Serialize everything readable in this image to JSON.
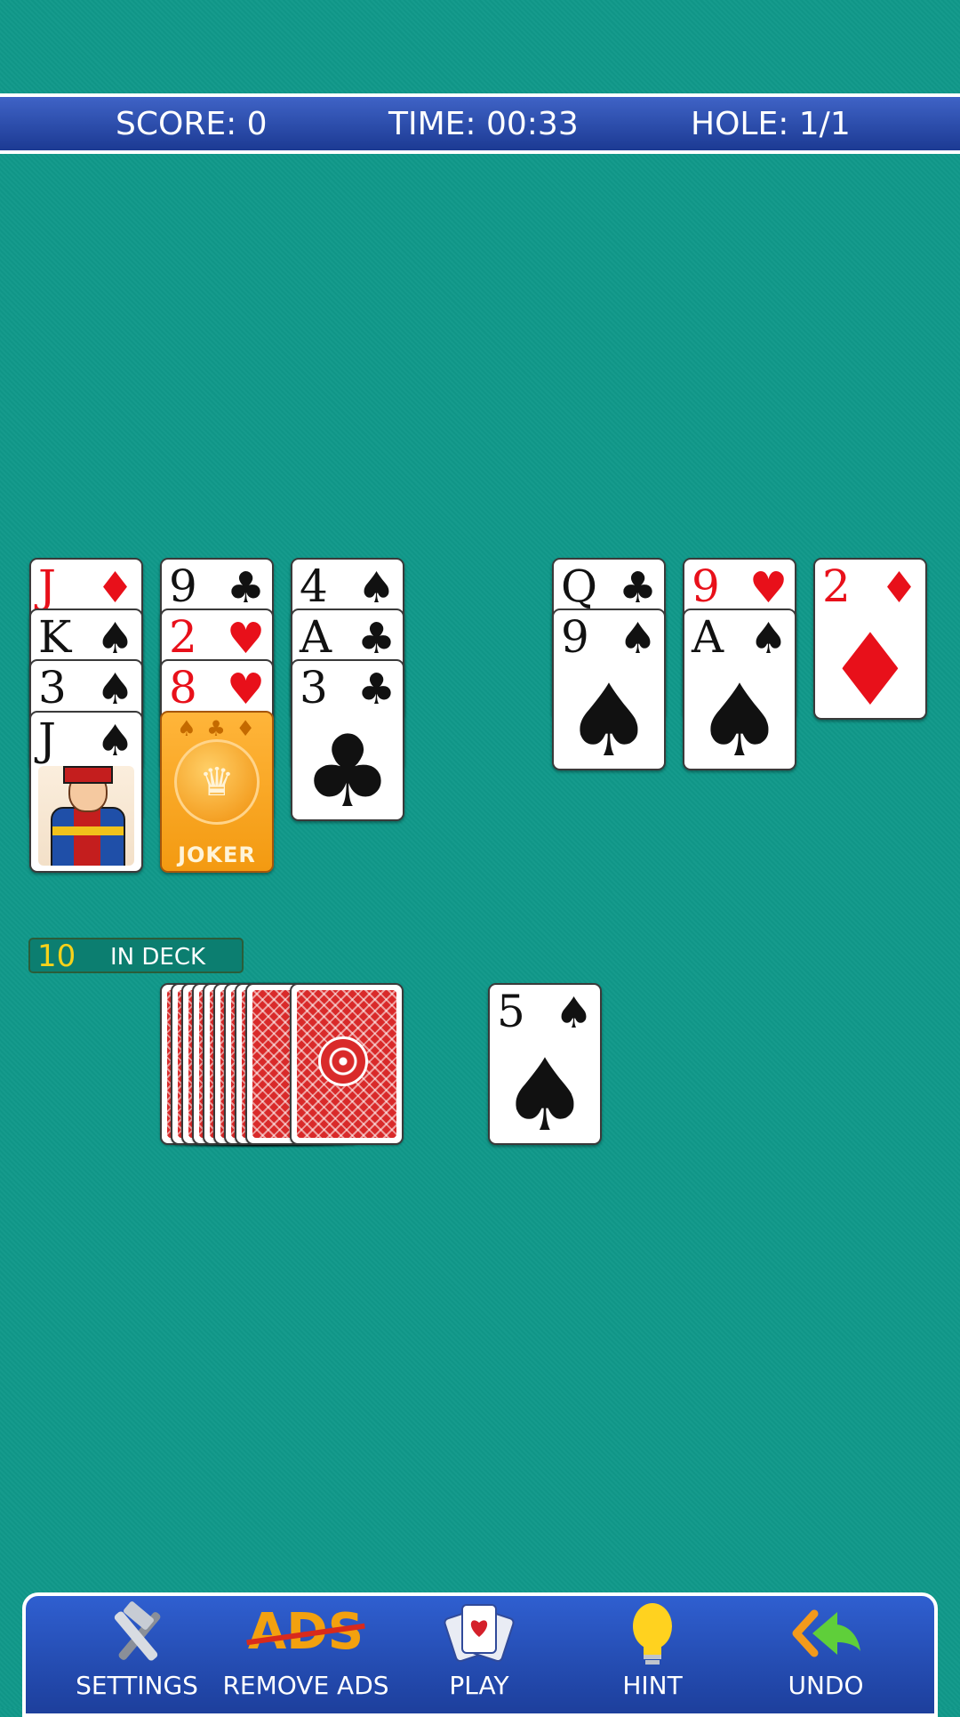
{
  "header": {
    "score": "SCORE: 0",
    "time": "TIME: 00:33",
    "hole": "HOLE: 1/1"
  },
  "tableau": {
    "column_1": [
      {
        "rank": "J",
        "suit": "♦",
        "color": "red"
      },
      {
        "rank": "K",
        "suit": "♠",
        "color": "black"
      },
      {
        "rank": "3",
        "suit": "♠",
        "color": "black"
      },
      {
        "rank": "J",
        "suit": "♠",
        "color": "black",
        "face": "jack-of-spades"
      }
    ],
    "column_2": [
      {
        "rank": "9",
        "suit": "♣",
        "color": "black"
      },
      {
        "rank": "2",
        "suit": "♥",
        "color": "red"
      },
      {
        "rank": "8",
        "suit": "♥",
        "color": "red"
      },
      {
        "joker": "JOKER"
      }
    ],
    "column_3": [
      {
        "rank": "4",
        "suit": "♠",
        "color": "black"
      },
      {
        "rank": "A",
        "suit": "♣",
        "color": "black"
      },
      {
        "rank": "3",
        "suit": "♣",
        "color": "black"
      }
    ],
    "column_4": [
      {
        "rank": "Q",
        "suit": "♣",
        "color": "black"
      },
      {
        "rank": "9",
        "suit": "♠",
        "color": "black"
      }
    ],
    "column_5": [
      {
        "rank": "9",
        "suit": "♥",
        "color": "red"
      },
      {
        "rank": "A",
        "suit": "♠",
        "color": "black"
      }
    ],
    "column_6": [
      {
        "rank": "2",
        "suit": "♦",
        "color": "red"
      }
    ]
  },
  "deck": {
    "count": "10",
    "label": "IN DECK",
    "back_color": "#d92a2a"
  },
  "waste": {
    "rank": "5",
    "suit": "♠",
    "color": "black"
  },
  "toolbar": {
    "settings": "SETTINGS",
    "ads_graphic": "ADS",
    "remove_ads": "REMOVE ADS",
    "play": "PLAY",
    "hint": "HINT",
    "undo": "UNDO"
  },
  "colors": {
    "felt": "#10998a",
    "bar_blue": "#2f5fd0",
    "red_suit": "#e8101a",
    "deck_count": "#f6d21a"
  }
}
